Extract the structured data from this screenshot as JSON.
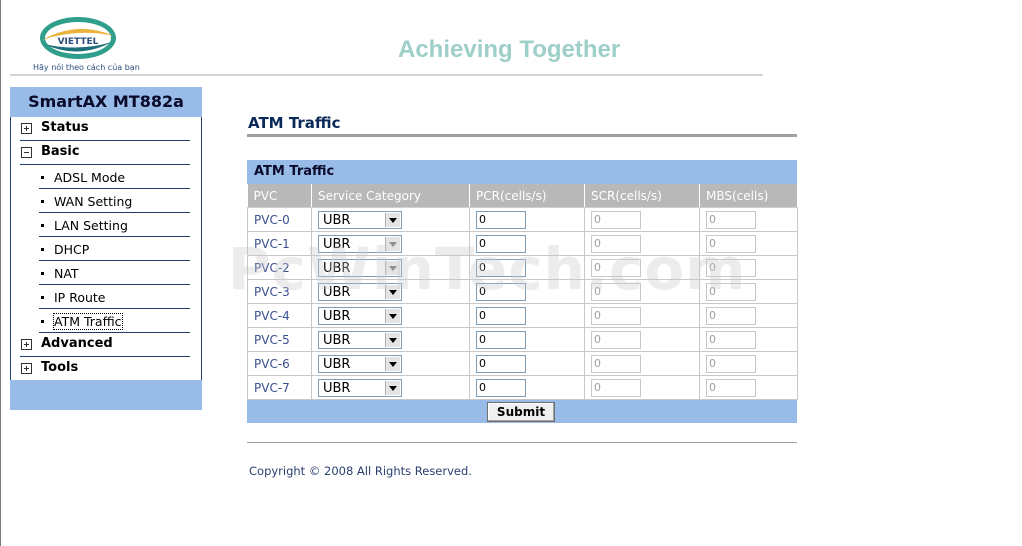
{
  "header": {
    "logo_text": "VIETTEL",
    "logo_tagline": "Hãy nói theo cách của bạn",
    "slogan": "Achieving Together"
  },
  "sidebar": {
    "title": "SmartAX MT882a",
    "groups": [
      {
        "label": "Status",
        "expanded": false
      },
      {
        "label": "Basic",
        "expanded": true
      },
      {
        "label": "Advanced",
        "expanded": false
      },
      {
        "label": "Tools",
        "expanded": false
      }
    ],
    "basic_items": [
      {
        "label": "ADSL Mode"
      },
      {
        "label": "WAN Setting"
      },
      {
        "label": "LAN Setting"
      },
      {
        "label": "DHCP"
      },
      {
        "label": "NAT"
      },
      {
        "label": "IP Route"
      },
      {
        "label": "ATM Traffic",
        "active": true
      }
    ]
  },
  "main": {
    "page_title": "ATM Traffic",
    "table_title": "ATM Traffic",
    "columns": [
      "PVC",
      "Service Category",
      "PCR(cells/s)",
      "SCR(cells/s)",
      "MBS(cells)"
    ],
    "rows": [
      {
        "pvc": "PVC-0",
        "category": "UBR",
        "category_enabled": true,
        "pcr": "0",
        "scr": "0",
        "mbs": "0"
      },
      {
        "pvc": "PVC-1",
        "category": "UBR",
        "category_enabled": false,
        "pcr": "0",
        "scr": "0",
        "mbs": "0"
      },
      {
        "pvc": "PVC-2",
        "category": "UBR",
        "category_enabled": false,
        "pcr": "0",
        "scr": "0",
        "mbs": "0"
      },
      {
        "pvc": "PVC-3",
        "category": "UBR",
        "category_enabled": true,
        "pcr": "0",
        "scr": "0",
        "mbs": "0"
      },
      {
        "pvc": "PVC-4",
        "category": "UBR",
        "category_enabled": true,
        "pcr": "0",
        "scr": "0",
        "mbs": "0"
      },
      {
        "pvc": "PVC-5",
        "category": "UBR",
        "category_enabled": true,
        "pcr": "0",
        "scr": "0",
        "mbs": "0"
      },
      {
        "pvc": "PVC-6",
        "category": "UBR",
        "category_enabled": true,
        "pcr": "0",
        "scr": "0",
        "mbs": "0"
      },
      {
        "pvc": "PVC-7",
        "category": "UBR",
        "category_enabled": true,
        "pcr": "0",
        "scr": "0",
        "mbs": "0"
      }
    ],
    "submit_label": "Submit",
    "copyright": "Copyright © 2008 All Rights Reserved."
  },
  "watermark": "PcWinTech.com",
  "colors": {
    "sidebar_bar": "#99bbe8",
    "header_row": "#b8b8b8",
    "title_text": "#0b2a5a",
    "slogan": "#9fcfc9"
  }
}
